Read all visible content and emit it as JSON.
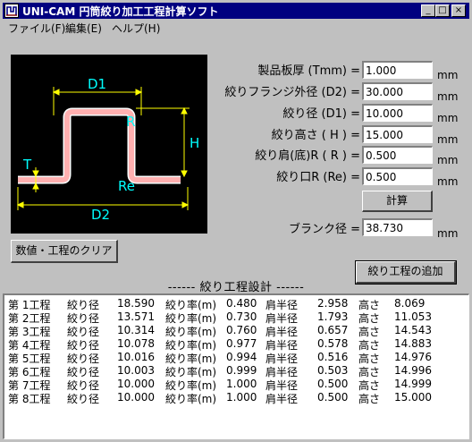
{
  "window": {
    "title": "UNI-CAM 円筒絞り加工工程計算ソフト",
    "minimize": "_",
    "maximize": "□",
    "close": "×"
  },
  "menu": [
    "ファイル(F)",
    "編集(E)",
    "ヘルプ(H)"
  ],
  "diagram": {
    "labels": {
      "d1": "D1",
      "d2": "D2",
      "r": "R",
      "re": "Re",
      "h": "H",
      "t": "T"
    },
    "colors": {
      "background": "#000000",
      "part": "#ffb0b0",
      "dimension": "#ffff00",
      "label": "#00ffff"
    }
  },
  "fields": [
    {
      "label": "製品板厚 (Tmm) =",
      "value": "1.000",
      "unit": "mm"
    },
    {
      "label": "絞りフランジ外径 (D2) =",
      "value": "30.000",
      "unit": "mm"
    },
    {
      "label": "絞り径 (D1) =",
      "value": "10.000",
      "unit": "mm"
    },
    {
      "label": "絞り高さ ( H ) =",
      "value": "15.000",
      "unit": "mm"
    },
    {
      "label": "絞り肩(底)R ( R ) =",
      "value": "0.500",
      "unit": "mm"
    },
    {
      "label": "絞り口R (Re) =",
      "value": "0.500",
      "unit": "mm"
    }
  ],
  "calc_button": "計算",
  "blank": {
    "label": "ブランク径 =",
    "value": "38.730",
    "unit": "mm"
  },
  "clear_button": "数値・工程のクリア",
  "add_button": "絞り工程の追加",
  "section_title": "------ 絞り工程設計 ------",
  "process_rows": [
    {
      "step": "第 1工程",
      "dlabel": "絞り径",
      "d": "18.590",
      "rlabel": "絞り率(m)",
      "m": "0.480",
      "klabel": "肩半径",
      "k": "2.958",
      "hlabel": "高さ",
      "h": "8.069"
    },
    {
      "step": "第 2工程",
      "dlabel": "絞り径",
      "d": "13.571",
      "rlabel": "絞り率(m)",
      "m": "0.730",
      "klabel": "肩半径",
      "k": "1.793",
      "hlabel": "高さ",
      "h": "11.053"
    },
    {
      "step": "第 3工程",
      "dlabel": "絞り径",
      "d": "10.314",
      "rlabel": "絞り率(m)",
      "m": "0.760",
      "klabel": "肩半径",
      "k": "0.657",
      "hlabel": "高さ",
      "h": "14.543"
    },
    {
      "step": "第 4工程",
      "dlabel": "絞り径",
      "d": "10.078",
      "rlabel": "絞り率(m)",
      "m": "0.977",
      "klabel": "肩半径",
      "k": "0.578",
      "hlabel": "高さ",
      "h": "14.883"
    },
    {
      "step": "第 5工程",
      "dlabel": "絞り径",
      "d": "10.016",
      "rlabel": "絞り率(m)",
      "m": "0.994",
      "klabel": "肩半径",
      "k": "0.516",
      "hlabel": "高さ",
      "h": "14.976"
    },
    {
      "step": "第 6工程",
      "dlabel": "絞り径",
      "d": "10.003",
      "rlabel": "絞り率(m)",
      "m": "0.999",
      "klabel": "肩半径",
      "k": "0.503",
      "hlabel": "高さ",
      "h": "14.996"
    },
    {
      "step": "第 7工程",
      "dlabel": "絞り径",
      "d": "10.000",
      "rlabel": "絞り率(m)",
      "m": "1.000",
      "klabel": "肩半径",
      "k": "0.500",
      "hlabel": "高さ",
      "h": "14.999"
    },
    {
      "step": "第 8工程",
      "dlabel": "絞り径",
      "d": "10.000",
      "rlabel": "絞り率(m)",
      "m": "1.000",
      "klabel": "肩半径",
      "k": "0.500",
      "hlabel": "高さ",
      "h": "15.000"
    }
  ]
}
